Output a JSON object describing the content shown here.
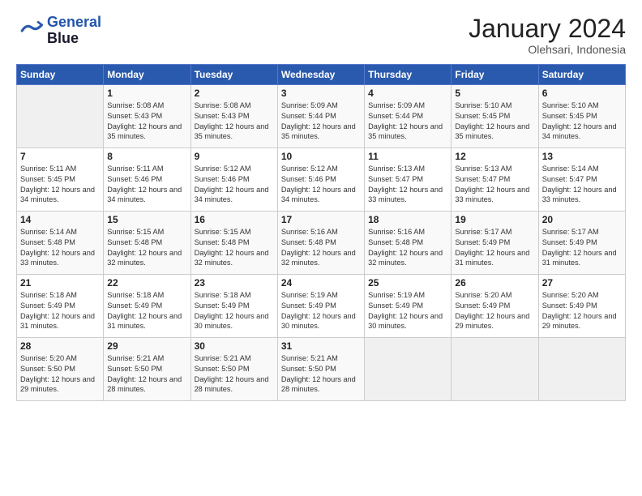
{
  "logo": {
    "line1": "General",
    "line2": "Blue"
  },
  "title": "January 2024",
  "subtitle": "Olehsari, Indonesia",
  "header_days": [
    "Sunday",
    "Monday",
    "Tuesday",
    "Wednesday",
    "Thursday",
    "Friday",
    "Saturday"
  ],
  "weeks": [
    [
      {
        "day": "",
        "text": ""
      },
      {
        "day": "1",
        "text": "Sunrise: 5:08 AM\nSunset: 5:43 PM\nDaylight: 12 hours\nand 35 minutes."
      },
      {
        "day": "2",
        "text": "Sunrise: 5:08 AM\nSunset: 5:43 PM\nDaylight: 12 hours\nand 35 minutes."
      },
      {
        "day": "3",
        "text": "Sunrise: 5:09 AM\nSunset: 5:44 PM\nDaylight: 12 hours\nand 35 minutes."
      },
      {
        "day": "4",
        "text": "Sunrise: 5:09 AM\nSunset: 5:44 PM\nDaylight: 12 hours\nand 35 minutes."
      },
      {
        "day": "5",
        "text": "Sunrise: 5:10 AM\nSunset: 5:45 PM\nDaylight: 12 hours\nand 35 minutes."
      },
      {
        "day": "6",
        "text": "Sunrise: 5:10 AM\nSunset: 5:45 PM\nDaylight: 12 hours\nand 34 minutes."
      }
    ],
    [
      {
        "day": "7",
        "text": "Sunrise: 5:11 AM\nSunset: 5:45 PM\nDaylight: 12 hours\nand 34 minutes."
      },
      {
        "day": "8",
        "text": "Sunrise: 5:11 AM\nSunset: 5:46 PM\nDaylight: 12 hours\nand 34 minutes."
      },
      {
        "day": "9",
        "text": "Sunrise: 5:12 AM\nSunset: 5:46 PM\nDaylight: 12 hours\nand 34 minutes."
      },
      {
        "day": "10",
        "text": "Sunrise: 5:12 AM\nSunset: 5:46 PM\nDaylight: 12 hours\nand 34 minutes."
      },
      {
        "day": "11",
        "text": "Sunrise: 5:13 AM\nSunset: 5:47 PM\nDaylight: 12 hours\nand 33 minutes."
      },
      {
        "day": "12",
        "text": "Sunrise: 5:13 AM\nSunset: 5:47 PM\nDaylight: 12 hours\nand 33 minutes."
      },
      {
        "day": "13",
        "text": "Sunrise: 5:14 AM\nSunset: 5:47 PM\nDaylight: 12 hours\nand 33 minutes."
      }
    ],
    [
      {
        "day": "14",
        "text": "Sunrise: 5:14 AM\nSunset: 5:48 PM\nDaylight: 12 hours\nand 33 minutes."
      },
      {
        "day": "15",
        "text": "Sunrise: 5:15 AM\nSunset: 5:48 PM\nDaylight: 12 hours\nand 32 minutes."
      },
      {
        "day": "16",
        "text": "Sunrise: 5:15 AM\nSunset: 5:48 PM\nDaylight: 12 hours\nand 32 minutes."
      },
      {
        "day": "17",
        "text": "Sunrise: 5:16 AM\nSunset: 5:48 PM\nDaylight: 12 hours\nand 32 minutes."
      },
      {
        "day": "18",
        "text": "Sunrise: 5:16 AM\nSunset: 5:48 PM\nDaylight: 12 hours\nand 32 minutes."
      },
      {
        "day": "19",
        "text": "Sunrise: 5:17 AM\nSunset: 5:49 PM\nDaylight: 12 hours\nand 31 minutes."
      },
      {
        "day": "20",
        "text": "Sunrise: 5:17 AM\nSunset: 5:49 PM\nDaylight: 12 hours\nand 31 minutes."
      }
    ],
    [
      {
        "day": "21",
        "text": "Sunrise: 5:18 AM\nSunset: 5:49 PM\nDaylight: 12 hours\nand 31 minutes."
      },
      {
        "day": "22",
        "text": "Sunrise: 5:18 AM\nSunset: 5:49 PM\nDaylight: 12 hours\nand 31 minutes."
      },
      {
        "day": "23",
        "text": "Sunrise: 5:18 AM\nSunset: 5:49 PM\nDaylight: 12 hours\nand 30 minutes."
      },
      {
        "day": "24",
        "text": "Sunrise: 5:19 AM\nSunset: 5:49 PM\nDaylight: 12 hours\nand 30 minutes."
      },
      {
        "day": "25",
        "text": "Sunrise: 5:19 AM\nSunset: 5:49 PM\nDaylight: 12 hours\nand 30 minutes."
      },
      {
        "day": "26",
        "text": "Sunrise: 5:20 AM\nSunset: 5:49 PM\nDaylight: 12 hours\nand 29 minutes."
      },
      {
        "day": "27",
        "text": "Sunrise: 5:20 AM\nSunset: 5:49 PM\nDaylight: 12 hours\nand 29 minutes."
      }
    ],
    [
      {
        "day": "28",
        "text": "Sunrise: 5:20 AM\nSunset: 5:50 PM\nDaylight: 12 hours\nand 29 minutes."
      },
      {
        "day": "29",
        "text": "Sunrise: 5:21 AM\nSunset: 5:50 PM\nDaylight: 12 hours\nand 28 minutes."
      },
      {
        "day": "30",
        "text": "Sunrise: 5:21 AM\nSunset: 5:50 PM\nDaylight: 12 hours\nand 28 minutes."
      },
      {
        "day": "31",
        "text": "Sunrise: 5:21 AM\nSunset: 5:50 PM\nDaylight: 12 hours\nand 28 minutes."
      },
      {
        "day": "",
        "text": ""
      },
      {
        "day": "",
        "text": ""
      },
      {
        "day": "",
        "text": ""
      }
    ]
  ]
}
